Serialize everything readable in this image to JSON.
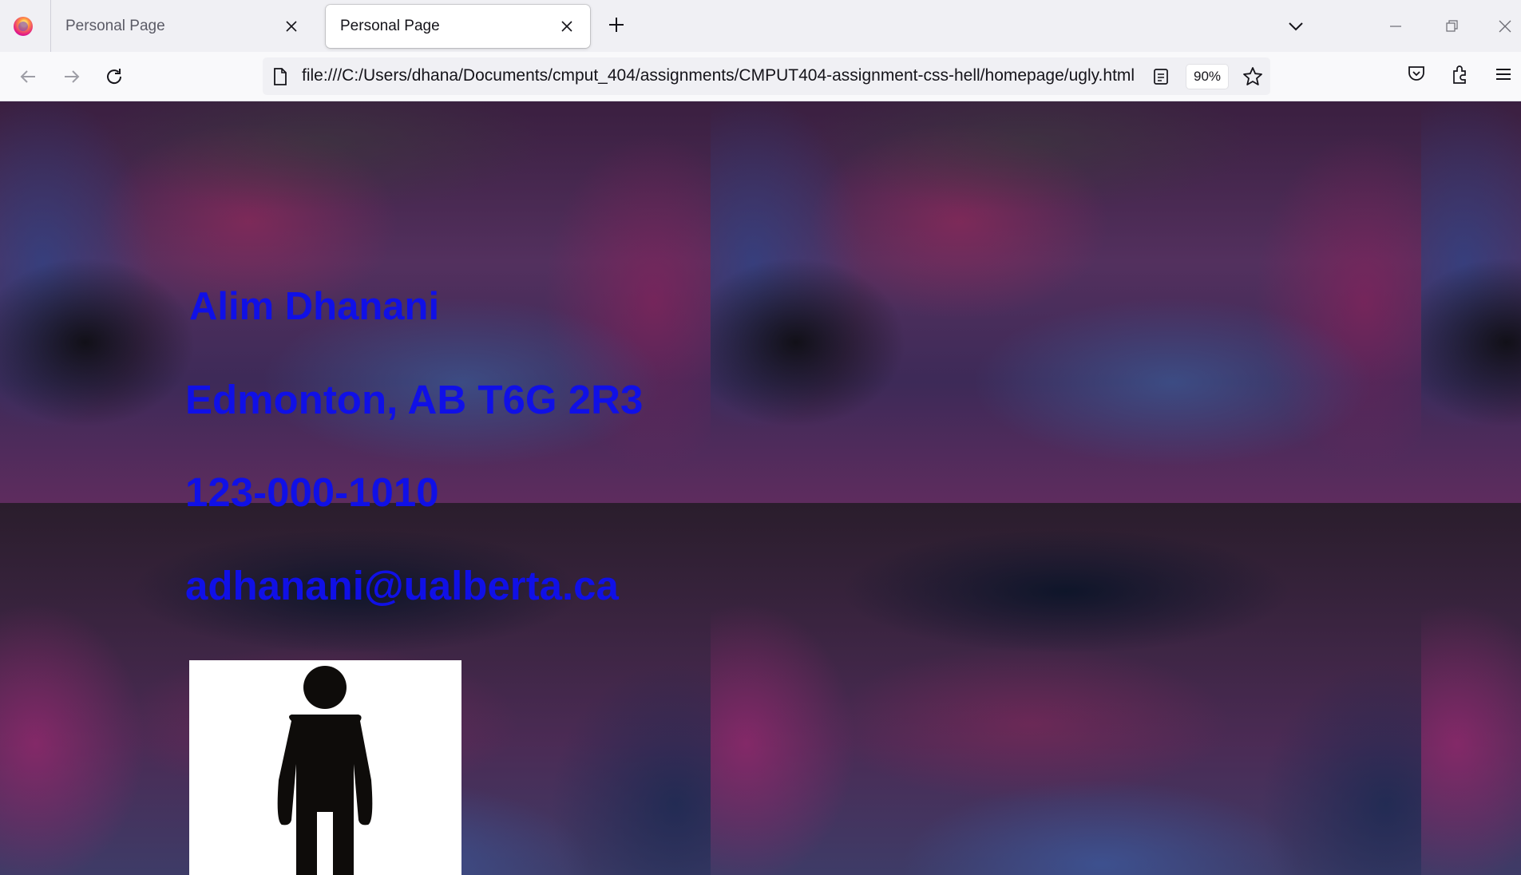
{
  "browser": {
    "tabs": [
      {
        "title": "Personal Page",
        "active": false
      },
      {
        "title": "Personal Page",
        "active": true
      }
    ],
    "url": "file:///C:/Users/dhana/Documents/cmput_404/assignments/CMPUT404-assignment-css-hell/homepage/ugly.html",
    "zoom": "90%",
    "icons": [
      "firefox-icon",
      "close-icon",
      "plus-icon",
      "chevron-down-icon",
      "minimize-icon",
      "restore-icon",
      "window-close-icon",
      "back-arrow-icon",
      "forward-arrow-icon",
      "reload-icon",
      "page-icon",
      "reader-view-icon",
      "star-icon",
      "pocket-icon",
      "extensions-icon",
      "hamburger-menu-icon"
    ]
  },
  "page": {
    "name": "Alim Dhanani",
    "city": "Edmonton, AB T6G 2R3",
    "phone": "123-000-1010",
    "email": "adhanani@ualberta.ca",
    "text_color": "#1010e6"
  }
}
